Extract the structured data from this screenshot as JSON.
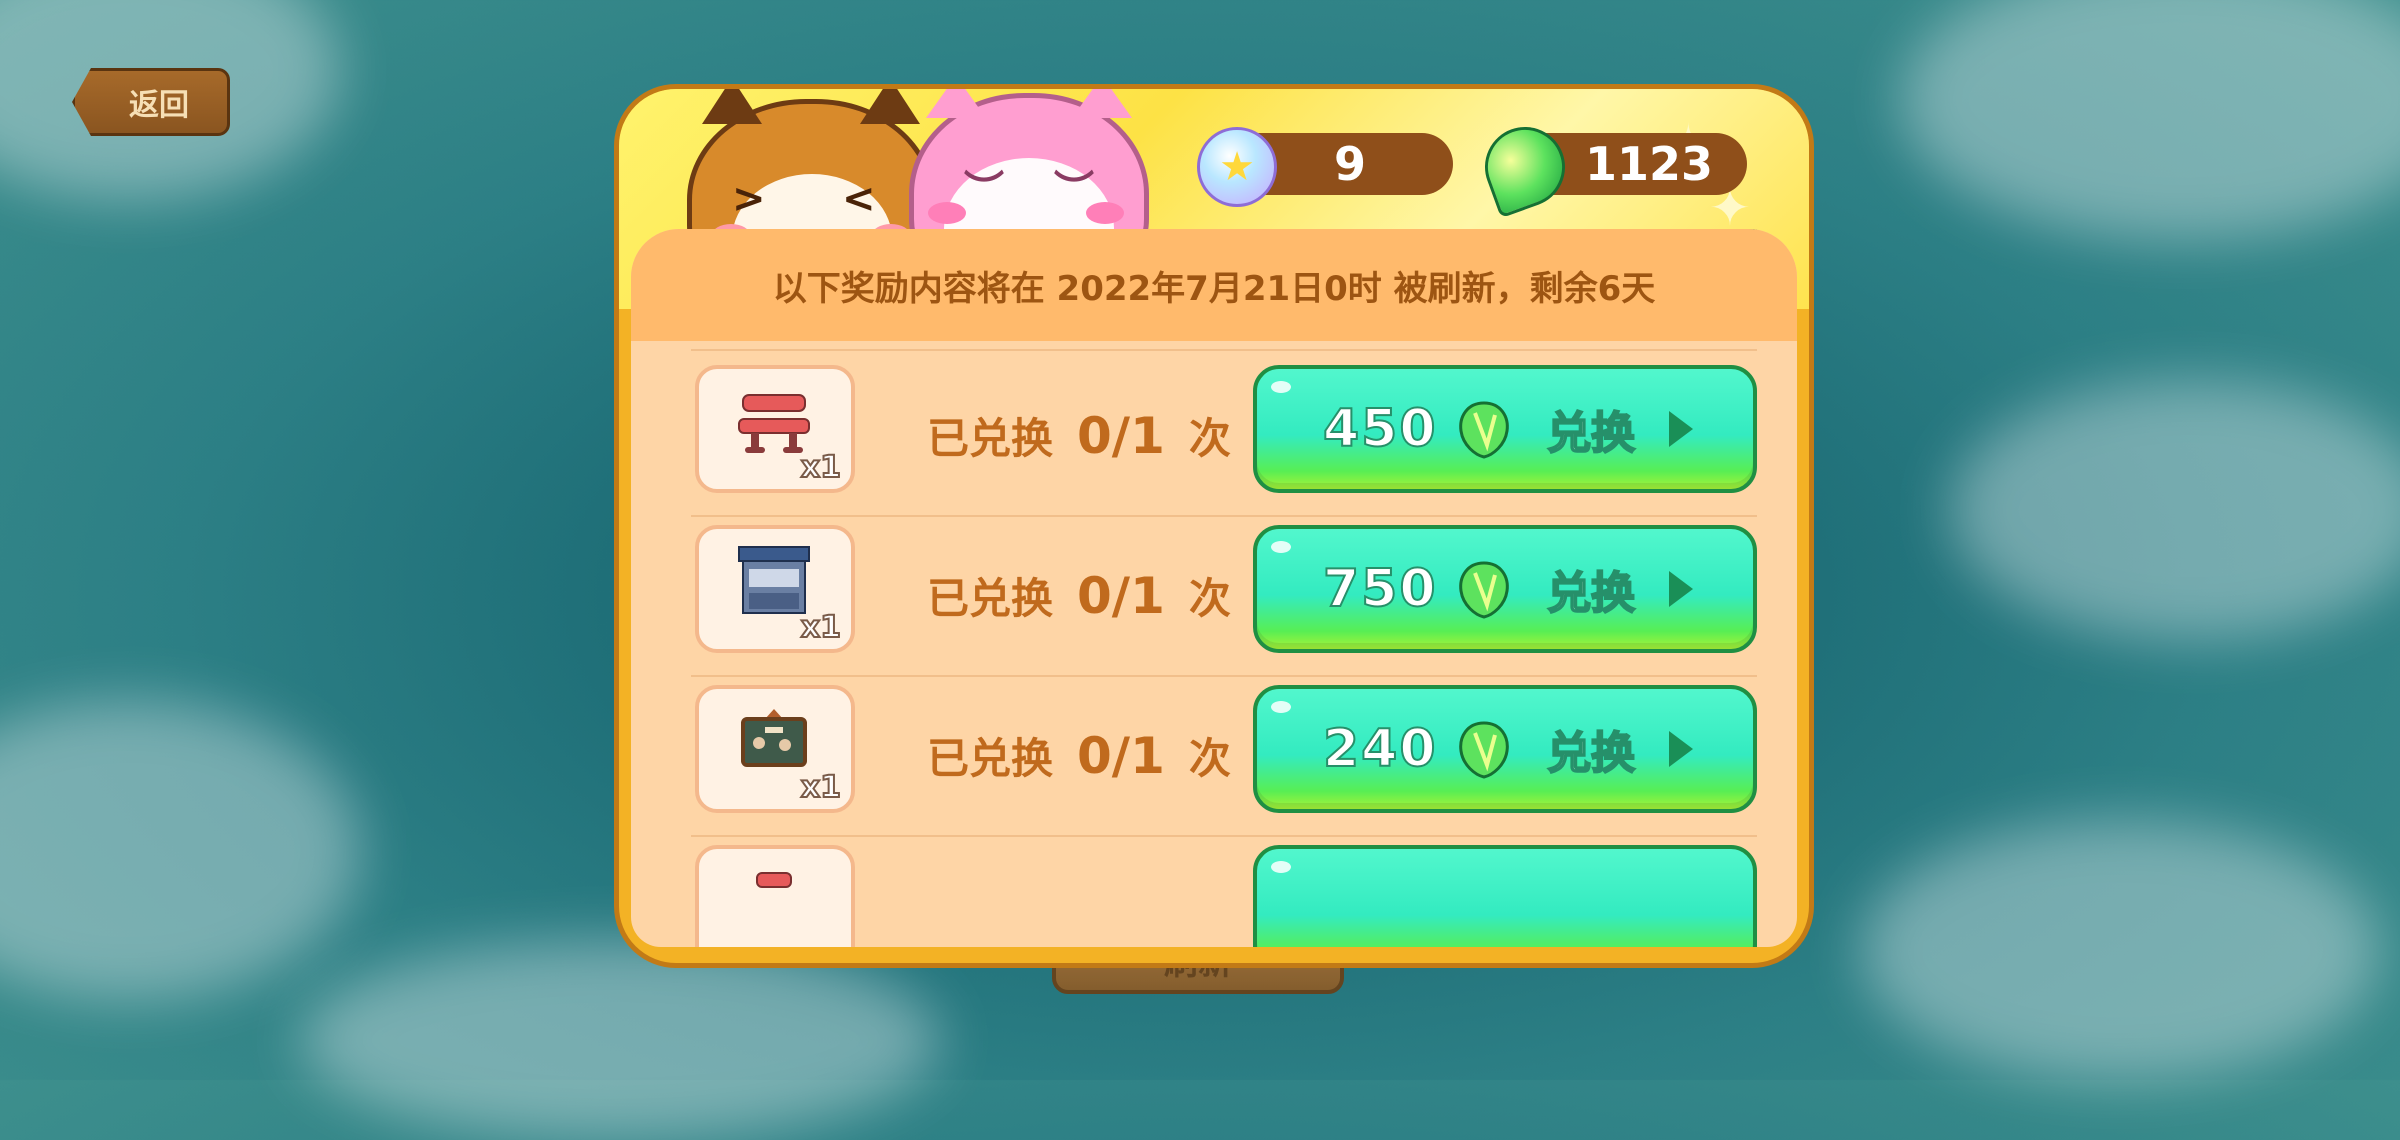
{
  "back_button": {
    "label": "返回"
  },
  "background_button": {
    "label": "刷新"
  },
  "currencies": {
    "star_gem": {
      "value": "9",
      "icon": "star-gem-icon"
    },
    "green_gem": {
      "value": "1123",
      "icon": "green-gem-icon"
    }
  },
  "banner": {
    "text": "以下奖励内容将在 2022年7月21日0时 被刷新，剩余6天"
  },
  "rows": [
    {
      "quantity": "x1",
      "redeemed_label": "",
      "count": "",
      "unit": "",
      "price": "",
      "button_label": "",
      "item": "partial-item"
    },
    {
      "quantity": "x1",
      "redeemed_label": "已兑换",
      "count": "0/1",
      "unit": "次",
      "price": "450",
      "button_label": "兑换",
      "item": "red-bench"
    },
    {
      "quantity": "x1",
      "redeemed_label": "已兑换",
      "count": "0/1",
      "unit": "次",
      "price": "750",
      "button_label": "兑换",
      "item": "shop-stall"
    },
    {
      "quantity": "x1",
      "redeemed_label": "已兑换",
      "count": "0/1",
      "unit": "次",
      "price": "240",
      "button_label": "兑换",
      "item": "chalkboard-sign"
    },
    {
      "quantity": "",
      "redeemed_label": "",
      "count": "",
      "unit": "",
      "price": "",
      "button_label": "",
      "item": "partial-item"
    }
  ],
  "colors": {
    "panel_border": "#f3b225",
    "inner_bg": "#fed5a6",
    "button_green": "#33ebc0",
    "text_brown": "#c06a1d"
  }
}
